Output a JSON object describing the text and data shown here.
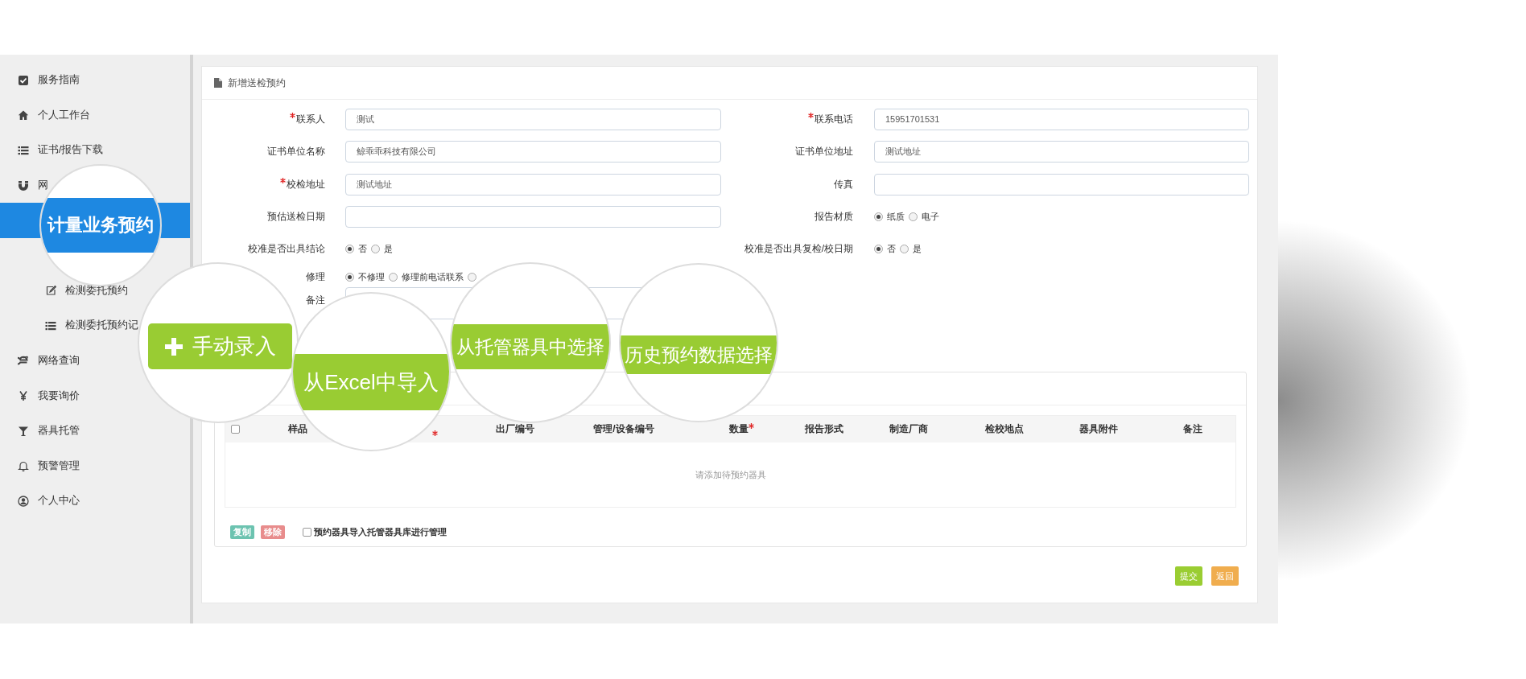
{
  "sidebar": {
    "items": [
      {
        "label": "服务指南",
        "selected": false
      },
      {
        "label": "个人工作台",
        "selected": false
      },
      {
        "label": "证书/报告下载",
        "selected": false
      },
      {
        "label": "网",
        "selected": false,
        "children": [
          {
            "label": "计量业务预约",
            "selected": true
          },
          {
            "label": "检测委托预约",
            "selected": false
          },
          {
            "label": "检测委托预约记",
            "selected": false
          }
        ]
      },
      {
        "label": "网络查询",
        "selected": false
      },
      {
        "label": "我要询价",
        "selected": false
      },
      {
        "label": "器具托管",
        "selected": false
      },
      {
        "label": "预警管理",
        "selected": false
      },
      {
        "label": "个人中心",
        "selected": false
      }
    ]
  },
  "card": {
    "title": "新增送检预约"
  },
  "form": {
    "rows": [
      {
        "left": {
          "label": "联系人",
          "required": true,
          "kind": "input",
          "value": "测试"
        },
        "right": {
          "label": "联系电话",
          "required": true,
          "kind": "input",
          "value": "15951701531"
        }
      },
      {
        "left": {
          "label": "证书单位名称",
          "required": false,
          "kind": "input",
          "value": "鲸乖乖科技有限公司"
        },
        "right": {
          "label": "证书单位地址",
          "required": false,
          "kind": "input",
          "value": "测试地址"
        }
      },
      {
        "left": {
          "label": "校检地址",
          "required": true,
          "kind": "input",
          "value": "测试地址"
        },
        "right": {
          "label": "传真",
          "required": false,
          "kind": "input"
        }
      },
      {
        "left": {
          "label": "预估送检日期",
          "required": false,
          "kind": "input"
        },
        "right": {
          "label": "报告材质",
          "required": false,
          "kind": "radio",
          "options": [
            {
              "label": "纸质",
              "selected": true
            },
            {
              "label": "电子",
              "selected": false
            }
          ]
        }
      },
      {
        "left": {
          "label": "校准是否出具结论",
          "required": false,
          "kind": "radio",
          "options": [
            {
              "label": "否",
              "selected": true
            },
            {
              "label": "是",
              "selected": false
            }
          ]
        },
        "right": {
          "label": "校准是否出具复检/校日期",
          "required": false,
          "kind": "radio",
          "options": [
            {
              "label": "否",
              "selected": true
            },
            {
              "label": "是",
              "selected": false
            }
          ]
        }
      },
      {
        "left": {
          "label": "修理",
          "required": false,
          "kind": "radio",
          "options": [
            {
              "label": "不修理",
              "selected": true
            },
            {
              "label": "修理前电话联系",
              "selected": false
            },
            {
              "selected": false
            }
          ]
        }
      },
      {
        "left": {
          "label": "备注",
          "required": false,
          "kind": "textarea"
        }
      }
    ]
  },
  "import_buttons": [
    {
      "label": "手动录入"
    },
    {
      "label": "从Excel中导入"
    },
    {
      "label": "从托管器具中选择"
    },
    {
      "label": "历史预约数据选择"
    }
  ],
  "table": {
    "columns": [
      {
        "kind": "checkbox",
        "checked": false
      },
      {
        "kind": "text",
        "label": "样品",
        "required": false
      },
      {
        "kind": "text",
        "required": true
      },
      {
        "kind": "text",
        "label": "出厂编号",
        "required": false
      },
      {
        "kind": "text",
        "label": "管理/设备编号",
        "required": false
      },
      {
        "kind": "text",
        "label": "数量",
        "required": true
      },
      {
        "kind": "text",
        "label": "报告形式",
        "required": false
      },
      {
        "kind": "text",
        "label": "制造厂商",
        "required": false
      },
      {
        "kind": "text",
        "label": "检校地点",
        "required": false
      },
      {
        "kind": "text",
        "label": "器具附件",
        "required": false
      },
      {
        "kind": "text",
        "label": "备注",
        "required": false
      }
    ],
    "empty_message": "请添加待预约器具"
  },
  "row_actions": [
    {
      "label": "复制",
      "color": "#6cc3b0"
    },
    {
      "label": "移除",
      "color": "#e88c8c"
    }
  ],
  "import_option": {
    "label": "预约器具导入托管器具库进行管理",
    "checked": false
  },
  "footer_buttons": [
    {
      "label": "提交",
      "color": "#9acd32"
    },
    {
      "label": "返回",
      "color": "#f0ad4e"
    }
  ]
}
